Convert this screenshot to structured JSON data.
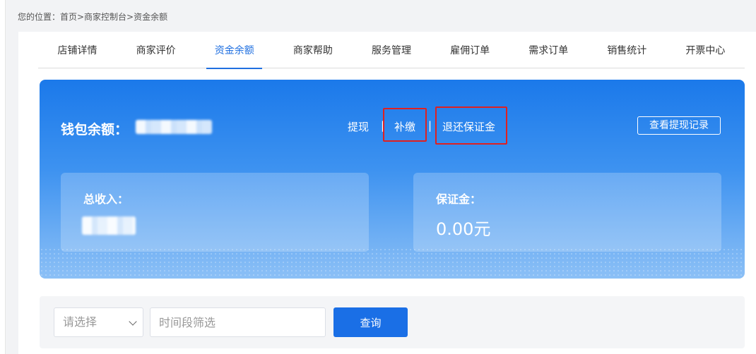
{
  "breadcrumb": "您的位置：首页>商家控制台>资金余额",
  "tabs": [
    {
      "label": "店铺详情"
    },
    {
      "label": "商家评价"
    },
    {
      "label": "资金余额",
      "active": true
    },
    {
      "label": "商家帮助"
    },
    {
      "label": "服务管理"
    },
    {
      "label": "雇佣订单"
    },
    {
      "label": "需求订单"
    },
    {
      "label": "销售统计"
    },
    {
      "label": "开票中心"
    }
  ],
  "wallet": {
    "label": "钱包余额：",
    "actions": {
      "withdraw": "提现",
      "supplement": "补缴",
      "refund_deposit": "退还保证金"
    },
    "separator": "|",
    "record_button": "查看提现记录"
  },
  "cards": {
    "income": {
      "label": "总收入："
    },
    "deposit": {
      "label": "保证金：",
      "value": "0.00元"
    }
  },
  "filter": {
    "select_placeholder": "请选择",
    "date_placeholder": "时间段筛选",
    "query_button": "查询"
  },
  "colors": {
    "accent": "#1f6fe0",
    "highlight_box": "#e02020"
  }
}
